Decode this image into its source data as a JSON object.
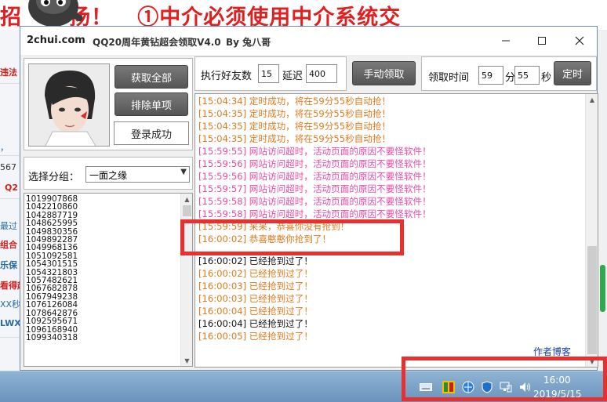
{
  "background": {
    "banner_part1": "招",
    "banner_part2": "扬！",
    "banner_part3": "①中介必须使用中介系统交",
    "left_fragments": [
      "违法",
      "，",
      "",
      "567",
      "Q2",
      "",
      "最过",
      "组合",
      "乐保 8",
      "看得起",
      "XX秒",
      "LWX"
    ]
  },
  "window": {
    "site": "2chui.com",
    "title": "QQ20周年黄钻超会领取V4.0",
    "author": "By 兔八哥"
  },
  "left_panel": {
    "get_all_label": "获取全部",
    "exclude_label": "排除单项",
    "login_status": "登录成功",
    "group_label": "选择分组：",
    "group_value": "一面之缘",
    "qq_numbers": [
      "1019907868",
      "1042210860",
      "1042887719",
      "1048625995",
      "1049830356",
      "1049892287",
      "1049968136",
      "1051092581",
      "1054301515",
      "1054321803",
      "1057482621",
      "1067682878",
      "1067949238",
      "1076126084",
      "1078642876",
      "1092595671",
      "1096168940",
      "1099340318"
    ]
  },
  "toolbar": {
    "friends_label": "执行好友数",
    "friends_value": "15",
    "delay_label": "延迟",
    "delay_value": "400",
    "manual_label": "手动领取",
    "time_label": "领取时间",
    "minute_value": "59",
    "minute_unit": "分",
    "second_value": "55",
    "second_unit": "秒",
    "timer_label": "定时"
  },
  "log": {
    "lines": [
      {
        "time": "[15:04:34]",
        "text": "定时成功，将在59分55秒自动抢！",
        "color": "#e07a1f"
      },
      {
        "time": "[15:04:35]",
        "text": "定时成功，将在59分55秒自动抢！",
        "color": "#e07a1f"
      },
      {
        "time": "[15:04:35]",
        "text": "定时成功，将在59分55秒自动抢！",
        "color": "#e07a1f"
      },
      {
        "time": "[15:04:35]",
        "text": "定时成功，将在59分55秒自动抢！",
        "color": "#e07a1f"
      },
      {
        "time": "[15:59:55]",
        "text": "网站访问超时，活动页面的原因不要怪软件！",
        "color": "#e84ca3"
      },
      {
        "time": "[15:59:56]",
        "text": "网站访问超时，活动页面的原因不要怪软件！",
        "color": "#e84ca3"
      },
      {
        "time": "[15:59:56]",
        "text": "网站访问超时，活动页面的原因不要怪软件！",
        "color": "#e84ca3"
      },
      {
        "time": "[15:59:57]",
        "text": "网站访问超时，活动页面的原因不要怪软件！",
        "color": "#e84ca3"
      },
      {
        "time": "[15:59:58]",
        "text": "网站访问超时，活动页面的原因不要怪软件！",
        "color": "#e84ca3"
      },
      {
        "time": "[15:59:58]",
        "text": "网站访问超时，活动页面的原因不要怪软件！",
        "color": "#e84ca3"
      },
      {
        "time": "[15:59:59]",
        "text": "呆呆，恭喜你没有抢到！",
        "color": "#e07a1f"
      },
      {
        "time": "[16:00:02]",
        "text": "恭喜憨憨你抢到了！",
        "color": "#e07a1f"
      },
      {
        "time": "",
        "text": "",
        "color": "",
        "blank": true
      },
      {
        "time": "[16:00:02]",
        "text": "已经抢到过了！",
        "color": "#111111"
      },
      {
        "time": "[16:00:02]",
        "text": "已经抢到过了！",
        "color": "#e07a1f"
      },
      {
        "time": "[16:00:03]",
        "text": "已经抢到过了！",
        "color": "#e07a1f"
      },
      {
        "time": "[16:00:03]",
        "text": "已经抢到过了！",
        "color": "#e07a1f"
      },
      {
        "time": "[16:00:04]",
        "text": "已经抢到过了！",
        "color": "#e07a1f"
      },
      {
        "time": "[16:00:04]",
        "text": "已经抢到过了！",
        "color": "#111111"
      },
      {
        "time": "[16:00:05]",
        "text": "已经抢到过了！",
        "color": "#e07a1f"
      }
    ],
    "blog_link": "作者博客"
  },
  "taskbar": {
    "time": "16:00",
    "date": "2019/5/15"
  },
  "colors": {
    "highlight_box": "#e8302f",
    "log_orange": "#e07a1f",
    "log_pink": "#e84ca3",
    "link_blue": "#1a3fae"
  }
}
